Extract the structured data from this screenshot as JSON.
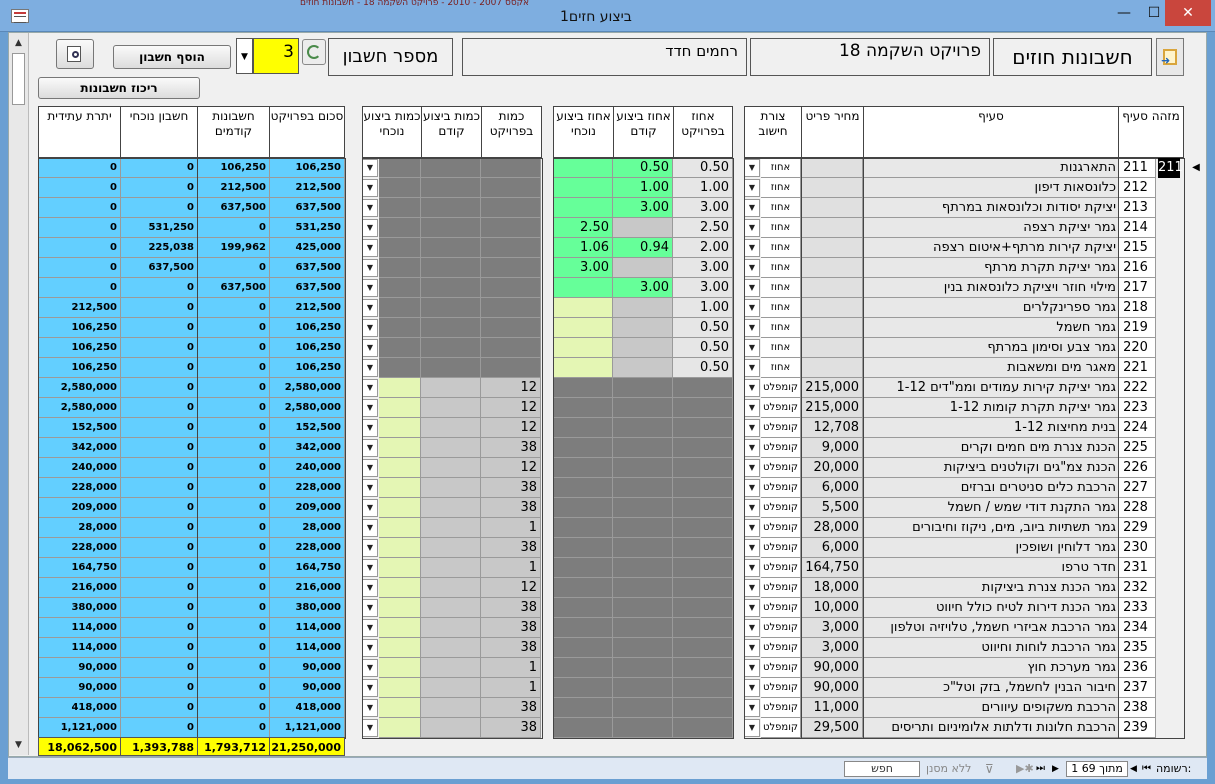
{
  "window": {
    "title": "ביצוע חזים1",
    "topstrip": "אקסס 2007 - 2010 - פרויקט השקמה 18 - חשבונות חוזים",
    "minimize": "—",
    "maximize": "☐",
    "close": "✕"
  },
  "header": {
    "back_icon": "exit-form-icon",
    "form_title": "חשבונות חוזים",
    "project": "פרויקט השקמה 18",
    "contractor": "רחמים חדד",
    "account_label": "מספר חשבון",
    "account_number": "3",
    "add_account": "הוסף חשבון",
    "summary": "ריכוז חשבונות",
    "refresh_icon": "refresh-icon",
    "preview_icon": "print-preview-icon"
  },
  "columns": {
    "item_id": "מזהה סעיף",
    "item": "סעיף",
    "unit_price": "מחיר פריט",
    "calc_type": "צורת חישוב",
    "pct_project": "אחוז בפרויקט",
    "pct_prev": "אחוז ביצוע קודם",
    "pct_curr": "אחוז ביצוע נוכחי",
    "qty_project": "כמות בפרויקט",
    "qty_prev": "כמות ביצוע קודם",
    "qty_curr": "כמות ביצוע נוכחי",
    "sum_project": "סכום בפרויקט",
    "prev_accounts": "חשבונות קודמים",
    "curr_account": "חשבון נוכחי",
    "future_balance": "יתרת עתידית"
  },
  "rows": [
    {
      "id": "211",
      "item": "התארגנות",
      "price": "",
      "calc": "אחוז",
      "pp": "0.50",
      "pprev": "0.50",
      "pcur": "",
      "qp": "",
      "qprev": "",
      "qcur": "",
      "sp": "106,250",
      "prev": "106,250",
      "cur": "0",
      "fut": "0"
    },
    {
      "id": "212",
      "item": "כלונסאות דיפון",
      "price": "",
      "calc": "אחוז",
      "pp": "1.00",
      "pprev": "1.00",
      "pcur": "",
      "qp": "",
      "qprev": "",
      "qcur": "",
      "sp": "212,500",
      "prev": "212,500",
      "cur": "0",
      "fut": "0"
    },
    {
      "id": "213",
      "item": "יציקת יסודות וכלונסאות במרתף",
      "price": "",
      "calc": "אחוז",
      "pp": "3.00",
      "pprev": "3.00",
      "pcur": "",
      "qp": "",
      "qprev": "",
      "qcur": "",
      "sp": "637,500",
      "prev": "637,500",
      "cur": "0",
      "fut": "0"
    },
    {
      "id": "214",
      "item": "גמר יציקת רצפה",
      "price": "",
      "calc": "אחוז",
      "pp": "2.50",
      "pprev": "",
      "pcur": "2.50",
      "qp": "",
      "qprev": "",
      "qcur": "",
      "sp": "531,250",
      "prev": "0",
      "cur": "531,250",
      "fut": "0"
    },
    {
      "id": "215",
      "item": "יציקת קירות מרתף+איטום רצפה",
      "price": "",
      "calc": "אחוז",
      "pp": "2.00",
      "pprev": "0.94",
      "pcur": "1.06",
      "qp": "",
      "qprev": "",
      "qcur": "",
      "sp": "425,000",
      "prev": "199,962",
      "cur": "225,038",
      "fut": "0"
    },
    {
      "id": "216",
      "item": "גמר יציקת תקרת מרתף",
      "price": "",
      "calc": "אחוז",
      "pp": "3.00",
      "pprev": "",
      "pcur": "3.00",
      "qp": "",
      "qprev": "",
      "qcur": "",
      "sp": "637,500",
      "prev": "0",
      "cur": "637,500",
      "fut": "0"
    },
    {
      "id": "217",
      "item": "מילוי חוזר ויציקת כלונסאות בנין",
      "price": "",
      "calc": "אחוז",
      "pp": "3.00",
      "pprev": "3.00",
      "pcur": "",
      "qp": "",
      "qprev": "",
      "qcur": "",
      "sp": "637,500",
      "prev": "637,500",
      "cur": "0",
      "fut": "0"
    },
    {
      "id": "218",
      "item": "גמר ספרינקלרים",
      "price": "",
      "calc": "אחוז",
      "pp": "1.00",
      "pprev": "",
      "pcur": "",
      "qp": "",
      "qprev": "",
      "qcur": "",
      "sp": "212,500",
      "prev": "0",
      "cur": "0",
      "fut": "212,500"
    },
    {
      "id": "219",
      "item": "גמר חשמל",
      "price": "",
      "calc": "אחוז",
      "pp": "0.50",
      "pprev": "",
      "pcur": "",
      "qp": "",
      "qprev": "",
      "qcur": "",
      "sp": "106,250",
      "prev": "0",
      "cur": "0",
      "fut": "106,250"
    },
    {
      "id": "220",
      "item": "גמר צבע וסימון במרתף",
      "price": "",
      "calc": "אחוז",
      "pp": "0.50",
      "pprev": "",
      "pcur": "",
      "qp": "",
      "qprev": "",
      "qcur": "",
      "sp": "106,250",
      "prev": "0",
      "cur": "0",
      "fut": "106,250"
    },
    {
      "id": "221",
      "item": "מאגר מים ומשאבות",
      "price": "",
      "calc": "אחוז",
      "pp": "0.50",
      "pprev": "",
      "pcur": "",
      "qp": "",
      "qprev": "",
      "qcur": "",
      "sp": "106,250",
      "prev": "0",
      "cur": "0",
      "fut": "106,250"
    },
    {
      "id": "222",
      "item": "גמר יציקת קירות עמודים וממ\"דים 1-12",
      "price": "215,000",
      "calc": "קומפלט",
      "pp": "",
      "pprev": "",
      "pcur": "",
      "qp": "12",
      "qprev": "",
      "qcur": "",
      "sp": "2,580,000",
      "prev": "0",
      "cur": "0",
      "fut": "2,580,000"
    },
    {
      "id": "223",
      "item": "גמר יציקת תקרת קומות 1-12",
      "price": "215,000",
      "calc": "קומפלט",
      "pp": "",
      "pprev": "",
      "pcur": "",
      "qp": "12",
      "qprev": "",
      "qcur": "",
      "sp": "2,580,000",
      "prev": "0",
      "cur": "0",
      "fut": "2,580,000"
    },
    {
      "id": "224",
      "item": "בנית מחיצות 1-12",
      "price": "12,708",
      "calc": "קומפלט",
      "pp": "",
      "pprev": "",
      "pcur": "",
      "qp": "12",
      "qprev": "",
      "qcur": "",
      "sp": "152,500",
      "prev": "0",
      "cur": "0",
      "fut": "152,500"
    },
    {
      "id": "225",
      "item": "הכנת צנרת מים חמים וקרים",
      "price": "9,000",
      "calc": "קומפלט",
      "pp": "",
      "pprev": "",
      "pcur": "",
      "qp": "38",
      "qprev": "",
      "qcur": "",
      "sp": "342,000",
      "prev": "0",
      "cur": "0",
      "fut": "342,000"
    },
    {
      "id": "226",
      "item": "הכנת צמ\"גים וקולטנים ביציקות",
      "price": "20,000",
      "calc": "קומפלט",
      "pp": "",
      "pprev": "",
      "pcur": "",
      "qp": "12",
      "qprev": "",
      "qcur": "",
      "sp": "240,000",
      "prev": "0",
      "cur": "0",
      "fut": "240,000"
    },
    {
      "id": "227",
      "item": "הרכבת כלים סניטרים וברזים",
      "price": "6,000",
      "calc": "קומפלט",
      "pp": "",
      "pprev": "",
      "pcur": "",
      "qp": "38",
      "qprev": "",
      "qcur": "",
      "sp": "228,000",
      "prev": "0",
      "cur": "0",
      "fut": "228,000"
    },
    {
      "id": "228",
      "item": "גמר התקנת דודי שמש / חשמל",
      "price": "5,500",
      "calc": "קומפלט",
      "pp": "",
      "pprev": "",
      "pcur": "",
      "qp": "38",
      "qprev": "",
      "qcur": "",
      "sp": "209,000",
      "prev": "0",
      "cur": "0",
      "fut": "209,000"
    },
    {
      "id": "229",
      "item": "גמר תשתיות ביוב, מים, ניקוז וחיבורים",
      "price": "28,000",
      "calc": "קומפלט",
      "pp": "",
      "pprev": "",
      "pcur": "",
      "qp": "1",
      "qprev": "",
      "qcur": "",
      "sp": "28,000",
      "prev": "0",
      "cur": "0",
      "fut": "28,000"
    },
    {
      "id": "230",
      "item": "גמר דלוחין ושופכין",
      "price": "6,000",
      "calc": "קומפלט",
      "pp": "",
      "pprev": "",
      "pcur": "",
      "qp": "38",
      "qprev": "",
      "qcur": "",
      "sp": "228,000",
      "prev": "0",
      "cur": "0",
      "fut": "228,000"
    },
    {
      "id": "231",
      "item": "חדר טרפו",
      "price": "164,750",
      "calc": "קומפלט",
      "pp": "",
      "pprev": "",
      "pcur": "",
      "qp": "1",
      "qprev": "",
      "qcur": "",
      "sp": "164,750",
      "prev": "0",
      "cur": "0",
      "fut": "164,750"
    },
    {
      "id": "232",
      "item": "גמר הכנת צנרת ביציקות",
      "price": "18,000",
      "calc": "קומפלט",
      "pp": "",
      "pprev": "",
      "pcur": "",
      "qp": "12",
      "qprev": "",
      "qcur": "",
      "sp": "216,000",
      "prev": "0",
      "cur": "0",
      "fut": "216,000"
    },
    {
      "id": "233",
      "item": "גמר הכנת דירות לטיח כולל חיווט",
      "price": "10,000",
      "calc": "קומפלט",
      "pp": "",
      "pprev": "",
      "pcur": "",
      "qp": "38",
      "qprev": "",
      "qcur": "",
      "sp": "380,000",
      "prev": "0",
      "cur": "0",
      "fut": "380,000"
    },
    {
      "id": "234",
      "item": "גמר הרכבת אביזרי חשמל, טלויזיה וטלפון",
      "price": "3,000",
      "calc": "קומפלט",
      "pp": "",
      "pprev": "",
      "pcur": "",
      "qp": "38",
      "qprev": "",
      "qcur": "",
      "sp": "114,000",
      "prev": "0",
      "cur": "0",
      "fut": "114,000"
    },
    {
      "id": "235",
      "item": "גמר הרכבת לוחות וחיווט",
      "price": "3,000",
      "calc": "קומפלט",
      "pp": "",
      "pprev": "",
      "pcur": "",
      "qp": "38",
      "qprev": "",
      "qcur": "",
      "sp": "114,000",
      "prev": "0",
      "cur": "0",
      "fut": "114,000"
    },
    {
      "id": "236",
      "item": "גמר מערכת חוץ",
      "price": "90,000",
      "calc": "קומפלט",
      "pp": "",
      "pprev": "",
      "pcur": "",
      "qp": "1",
      "qprev": "",
      "qcur": "",
      "sp": "90,000",
      "prev": "0",
      "cur": "0",
      "fut": "90,000"
    },
    {
      "id": "237",
      "item": "חיבור הבנין לחשמל, בזק וטל\"כ",
      "price": "90,000",
      "calc": "קומפלט",
      "pp": "",
      "pprev": "",
      "pcur": "",
      "qp": "1",
      "qprev": "",
      "qcur": "",
      "sp": "90,000",
      "prev": "0",
      "cur": "0",
      "fut": "90,000"
    },
    {
      "id": "238",
      "item": "הרכבת משקופים עיוורים",
      "price": "11,000",
      "calc": "קומפלט",
      "pp": "",
      "pprev": "",
      "pcur": "",
      "qp": "38",
      "qprev": "",
      "qcur": "",
      "sp": "418,000",
      "prev": "0",
      "cur": "0",
      "fut": "418,000"
    },
    {
      "id": "239",
      "item": "הרכבת חלונות ודלתות אלומיניום ותריסים",
      "price": "29,500",
      "calc": "קומפלט",
      "pp": "",
      "pprev": "",
      "pcur": "",
      "qp": "38",
      "qprev": "",
      "qcur": "",
      "sp": "1,121,000",
      "prev": "0",
      "cur": "0",
      "fut": "1,121,000"
    }
  ],
  "totals": {
    "sum_project": "21,250,000",
    "prev_accounts": "1,793,712",
    "curr_account": "1,393,788",
    "future_balance": "18,062,500"
  },
  "statusbar": {
    "record_label": "רשומה:",
    "record_position": "1 מתוך 69",
    "filter": "ללא מסנן",
    "search": "חפש"
  },
  "colors": {
    "title_blue": "#7eaee0",
    "green": "#66ff99",
    "light_green": "#e4f6b4",
    "dark_gray": "#7d7d7d",
    "gray": "#c8c8c8",
    "cyan": "#63cfff",
    "yellow": "#ffff00"
  }
}
